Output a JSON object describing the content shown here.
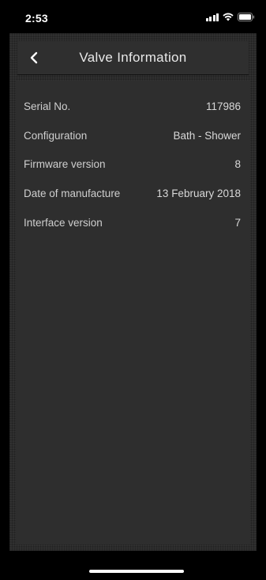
{
  "status_bar": {
    "time": "2:53"
  },
  "header": {
    "title": "Valve Information",
    "back_icon": "chevron-left-icon"
  },
  "info_rows": [
    {
      "label": "Serial No.",
      "value": "117986"
    },
    {
      "label": "Configuration",
      "value": "Bath - Shower"
    },
    {
      "label": "Firmware version",
      "value": "8"
    },
    {
      "label": "Date of manufacture",
      "value": "13 February 2018"
    },
    {
      "label": "Interface version",
      "value": "7"
    }
  ],
  "colors": {
    "background": "#000000",
    "panel": "#2b2b2b",
    "text": "#d0d0d0"
  }
}
